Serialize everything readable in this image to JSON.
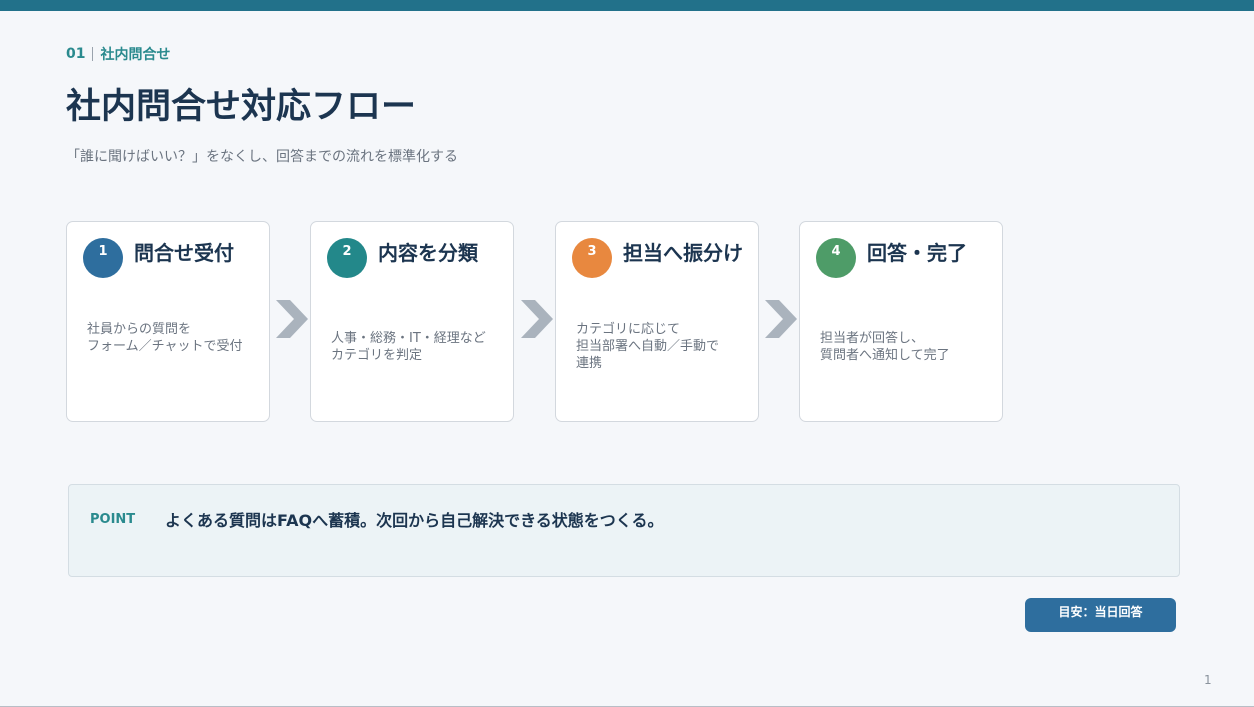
{
  "header": {
    "section_number": "01",
    "section_name": "社内問合せ",
    "title": "社内問合せ対応フロー",
    "subtitle": "「誰に聞けばいい？」をなくし、回答までの流れを標準化する"
  },
  "steps": [
    {
      "number": "1",
      "title": "問合せ受付",
      "description": "社員からの質問を\nフォーム／チャットで受付",
      "color": "#2e6e9e"
    },
    {
      "number": "2",
      "title": "内容を分類",
      "description": "人事・総務・IT・経理など\nカテゴリを判定",
      "color": "#23888a"
    },
    {
      "number": "3",
      "title": "担当へ振分け",
      "description": "カテゴリに応じて\n担当部署へ自動／手動で\n連携",
      "color": "#e8883f"
    },
    {
      "number": "4",
      "title": "回答・完了",
      "description": "担当者が回答し、\n質問者へ通知して完了",
      "color": "#4e9c68"
    }
  ],
  "point": {
    "label": "POINT",
    "text": "よくある質問はFAQへ蓄積。次回から自己解決できる状態をつくる。"
  },
  "badge": "目安：当日回答",
  "page_number": "1",
  "colors": {
    "top_bar": "#22718a",
    "accent_teal": "#2a8a8e",
    "title_navy": "#1c3550",
    "arrow_gray": "#aab3bd"
  }
}
